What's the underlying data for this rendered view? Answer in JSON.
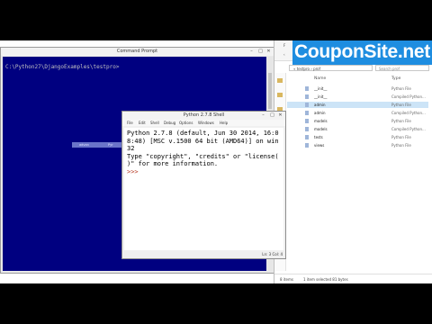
{
  "banner": {
    "text": "CouponSite.net"
  },
  "cmd": {
    "title": "Command Prompt",
    "line": "C:\\Python27\\DjangoExamples\\testpro>",
    "controls": [
      "–",
      "□",
      "✕"
    ]
  },
  "selection_strip": {
    "left": "advan",
    "right": "Pyr"
  },
  "python_shell": {
    "title": "Python 2.7.8 Shell",
    "menu": [
      "File",
      "Edit",
      "Shell",
      "Debug",
      "Options",
      "Windows",
      "Help"
    ],
    "lines": [
      "Python 2.7.8 (default, Jun 30 2014, 16:0",
      "8:48) [MSC v.1500 64 bit (AMD64)] on win",
      "32",
      "Type \"copyright\", \"credits\" or \"license(",
      ")\" for more information.",
      ">>> "
    ],
    "status": "Ln: 3 Col: 4"
  },
  "explorer": {
    "path": "« testpro › prof",
    "search_placeholder": "Search prof",
    "header": {
      "name": "Name",
      "type": "Type"
    },
    "files": [
      {
        "name": "__init__",
        "type": "Python File"
      },
      {
        "name": "__init__",
        "type": "Compiled Python..."
      },
      {
        "name": "admin",
        "type": "Python File"
      },
      {
        "name": "admin",
        "type": "Compiled Python..."
      },
      {
        "name": "models",
        "type": "Python File"
      },
      {
        "name": "models",
        "type": "Compiled Python..."
      },
      {
        "name": "tests",
        "type": "Python File"
      },
      {
        "name": "views",
        "type": "Python File"
      }
    ],
    "status_left": "8 items",
    "status_mid": "1 item selected 81 bytes"
  }
}
